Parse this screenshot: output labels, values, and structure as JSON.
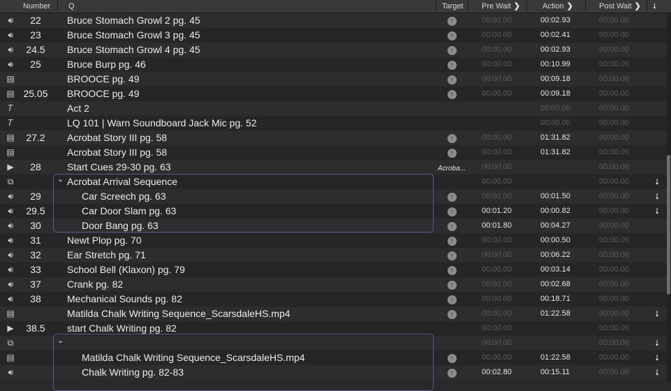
{
  "header": {
    "number": "Number",
    "q": "Q",
    "target": "Target",
    "pre_wait": "Pre Wait",
    "action": "Action",
    "post_wait": "Post Wait"
  },
  "rows": [
    {
      "type": "audio",
      "icon": "speaker-icon",
      "number": "22",
      "q": "Bruce Stomach Growl 2 pg. 45",
      "target": "circle",
      "pre": "00:00.00",
      "action": "00:02.93",
      "post": "00:00.00",
      "indent": false
    },
    {
      "type": "audio",
      "icon": "speaker-icon",
      "number": "23",
      "q": "Bruce Stomach Growl 3 pg. 45",
      "target": "circle",
      "pre": "00:00.00",
      "action": "00:02.41",
      "post": "00:00.00",
      "indent": false
    },
    {
      "type": "audio",
      "icon": "speaker-icon",
      "number": "24.5",
      "q": "Bruce Stomach Growl 4 pg. 45",
      "target": "circle",
      "pre": "00:00.00",
      "action": "00:02.93",
      "post": "00:00.00",
      "indent": false
    },
    {
      "type": "audio",
      "icon": "speaker-icon",
      "number": "25",
      "q": "Bruce Burp pg. 46",
      "target": "circle",
      "pre": "00:00.00",
      "action": "00:10.99",
      "post": "00:00.00",
      "indent": false
    },
    {
      "type": "video",
      "icon": "film-icon",
      "number": "",
      "q": "BROOCE pg. 49",
      "target": "circle",
      "pre": "00:00.00",
      "action": "00:09.18",
      "post": "00:00.00",
      "indent": false
    },
    {
      "type": "video",
      "icon": "film-icon",
      "number": "25.05",
      "q": "BROOCE pg. 49",
      "target": "circle",
      "pre": "00:00.00",
      "action": "00:09.18",
      "post": "00:00.00",
      "indent": false
    },
    {
      "type": "text",
      "icon": "text-icon",
      "number": "",
      "q": "Act 2",
      "target": "",
      "pre": "",
      "action": "00:00.00",
      "post": "00:00.00",
      "indent": false
    },
    {
      "type": "text",
      "icon": "text-icon",
      "number": "",
      "q": "LQ 101 | Warn Soundboard Jack Mic pg. 52",
      "target": "",
      "pre": "",
      "action": "00:00.00",
      "post": "00:00.00",
      "indent": false
    },
    {
      "type": "video",
      "icon": "film-icon",
      "number": "27.2",
      "q": "Acrobat Story III pg. 58",
      "target": "circle",
      "pre": "00:00.00",
      "action": "01:31.82",
      "post": "00:00.00",
      "indent": false
    },
    {
      "type": "video",
      "icon": "film-icon",
      "number": "",
      "q": "Acrobat Story III pg. 58",
      "target": "circle",
      "pre": "00:00.00",
      "action": "01:31.82",
      "post": "00:00.00",
      "indent": false
    },
    {
      "type": "start",
      "icon": "play-icon",
      "number": "28",
      "q": "Start Cues 29-30 pg. 63",
      "target": "Acroba...",
      "pre": "00:00.00",
      "action": "",
      "post": "00:00.00",
      "indent": false
    },
    {
      "type": "group",
      "icon": "group-icon",
      "number": "",
      "q": "Acrobat Arrival Sequence",
      "target": "",
      "pre": "00:00.00",
      "action": "",
      "post": "00:00.00",
      "indent": false,
      "chevron": "⌄",
      "arrow": "⭣"
    },
    {
      "type": "audio",
      "icon": "speaker-icon",
      "number": "29",
      "q": "Car Screech pg. 63",
      "target": "circle",
      "pre": "00:00.00",
      "action": "00:01.50",
      "post": "00:00.00",
      "indent": true,
      "arrow": "⭣"
    },
    {
      "type": "audio",
      "icon": "speaker-icon",
      "number": "29.5",
      "q": "Car Door Slam pg. 63",
      "target": "circle",
      "pre": "00:01.20",
      "action": "00:00.82",
      "post": "00:00.00",
      "indent": true,
      "arrow": "⭣"
    },
    {
      "type": "audio",
      "icon": "speaker-icon",
      "number": "30",
      "q": "Door Bang pg. 63",
      "target": "circle",
      "pre": "00:01.80",
      "action": "00:04.27",
      "post": "00:00.00",
      "indent": true
    },
    {
      "type": "audio",
      "icon": "speaker-icon",
      "number": "31",
      "q": "Newt Plop pg. 70",
      "target": "circle",
      "pre": "00:00.00",
      "action": "00:00.50",
      "post": "00:00.00",
      "indent": false
    },
    {
      "type": "audio",
      "icon": "speaker-icon",
      "number": "32",
      "q": "Ear Stretch pg. 71",
      "target": "circle",
      "pre": "00:00.00",
      "action": "00:06.22",
      "post": "00:00.00",
      "indent": false
    },
    {
      "type": "audio",
      "icon": "speaker-icon",
      "number": "33",
      "q": "School Bell (Klaxon) pg. 79",
      "target": "circle",
      "pre": "00:00.00",
      "action": "00:03.14",
      "post": "00:00.00",
      "indent": false
    },
    {
      "type": "audio",
      "icon": "speaker-icon",
      "number": "37",
      "q": "Crank pg. 82",
      "target": "circle",
      "pre": "00:00.00",
      "action": "00:02.68",
      "post": "00:00.00",
      "indent": false
    },
    {
      "type": "audio",
      "icon": "speaker-icon",
      "number": "38",
      "q": "Mechanical Sounds pg. 82",
      "target": "circle",
      "pre": "00:00.00",
      "action": "00:18.71",
      "post": "00:00.00",
      "indent": false
    },
    {
      "type": "video",
      "icon": "film-icon",
      "number": "",
      "q": "Matilda Chalk Writing Sequence_ScarsdaleHS.mp4",
      "target": "circle",
      "pre": "00:00.00",
      "action": "01:22.58",
      "post": "00:00.00",
      "indent": false,
      "arrow": "⭣"
    },
    {
      "type": "start",
      "icon": "play-icon",
      "number": "38.5",
      "q": "start Chalk Writing pg. 82",
      "target": "",
      "pre": "00:00.00",
      "action": "",
      "post": "00:00.00",
      "indent": false
    },
    {
      "type": "group",
      "icon": "group-icon",
      "number": "",
      "q": "",
      "target": "",
      "pre": "00:00.00",
      "action": "",
      "post": "00:00.00",
      "indent": false,
      "chevron": "⌄",
      "arrow": "⭣"
    },
    {
      "type": "video",
      "icon": "film-icon",
      "number": "",
      "q": "Matilda Chalk Writing Sequence_ScarsdaleHS.mp4",
      "target": "circle",
      "pre": "00:00.00",
      "action": "01:22.58",
      "post": "00:00.00",
      "indent": true,
      "arrow": "⭣"
    },
    {
      "type": "audio",
      "icon": "speaker-icon",
      "number": "",
      "q": "Chalk Writing pg. 82-83",
      "target": "circle",
      "pre": "00:02.80",
      "action": "00:15.11",
      "post": "00:00.00",
      "indent": true,
      "arrow": "⭣"
    }
  ]
}
